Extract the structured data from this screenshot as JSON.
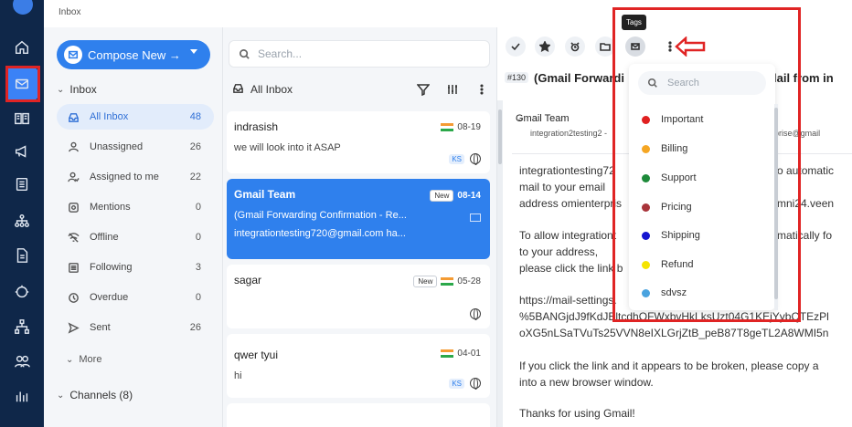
{
  "breadcrumb": "Inbox",
  "rail": {
    "icons": [
      "home-icon",
      "mail-icon",
      "book-icon",
      "megaphone-icon",
      "contacts-icon",
      "hierarchy-icon",
      "document-icon",
      "bot-icon",
      "org-chart-icon",
      "team-icon",
      "analytics-icon"
    ]
  },
  "nav": {
    "compose_label": "Compose New →",
    "inbox_section": "Inbox",
    "items": [
      {
        "label": "All Inbox",
        "count": "48"
      },
      {
        "label": "Unassigned",
        "count": "26"
      },
      {
        "label": "Assigned to me",
        "count": "22"
      },
      {
        "label": "Mentions",
        "count": "0"
      },
      {
        "label": "Offline",
        "count": "0"
      },
      {
        "label": "Following",
        "count": "3"
      },
      {
        "label": "Overdue",
        "count": "0"
      },
      {
        "label": "Sent",
        "count": "26"
      }
    ],
    "more_label": "More",
    "channels_label": "Channels (8)"
  },
  "list": {
    "search_placeholder": "Search...",
    "header": "All Inbox",
    "cards": [
      {
        "name": "indrasish",
        "date": "08-19",
        "snippet": "we will look into it  ASAP",
        "agent": "KS"
      },
      {
        "name": "Gmail Team",
        "badge": "New",
        "date": "08-14",
        "subject": "(Gmail Forwarding Confirmation - Re...",
        "snippet": "integrationtesting720@gmail.com ha..."
      },
      {
        "name": "sagar",
        "badge": "New",
        "date": "05-28"
      },
      {
        "name": "qwer tyui",
        "date": "04-01",
        "snippet": "hi",
        "agent": "KS"
      }
    ]
  },
  "detail": {
    "tooltip": "Tags",
    "subject_id": "#130",
    "subject": "(Gmail Forwardi",
    "subject_right": "lail from in",
    "sender": "Gmail Team",
    "sender_sub": "integration2testing2 -",
    "sender_right": "prise@gmail",
    "body": [
      {
        "l": "integrationtesting72",
        "r": "o automatic"
      },
      {
        "l": "mail to your email",
        "r": ""
      },
      {
        "l": "address omienterpris",
        "r": "mni24.veen"
      },
      {
        "l": "To allow integrationt",
        "r": "matically fo"
      },
      {
        "l": "to your address,",
        "r": ""
      },
      {
        "l": "please click the link b",
        "r": ""
      },
      {
        "l": "https://mail-settings.",
        "r": ""
      },
      {
        "l": "%5BANGjdJ9fKdJBltcdhOFWxbvHkLksUzt04G1KEjYybQTEzPl",
        "r": ""
      },
      {
        "l": "oXG5nLSaTVuTs25VVN8eIXLGrjZtB_peB87T8geTL2A8WMI5n",
        "r": ""
      },
      {
        "l": "If you click the link and it appears to be broken, please copy a",
        "r": ""
      },
      {
        "l": "into a new browser window.",
        "r": ""
      },
      {
        "l": "Thanks for using Gmail!",
        "r": ""
      }
    ]
  },
  "tags": {
    "search_placeholder": "Search",
    "items": [
      {
        "label": "Important",
        "color": "#e02020"
      },
      {
        "label": "Billing",
        "color": "#f5a623"
      },
      {
        "label": "Support",
        "color": "#1e8a3a"
      },
      {
        "label": "Pricing",
        "color": "#a8343a"
      },
      {
        "label": "Shipping",
        "color": "#1515d0"
      },
      {
        "label": "Refund",
        "color": "#f5e400"
      },
      {
        "label": "sdvsz",
        "color": "#4aa3df"
      }
    ]
  }
}
